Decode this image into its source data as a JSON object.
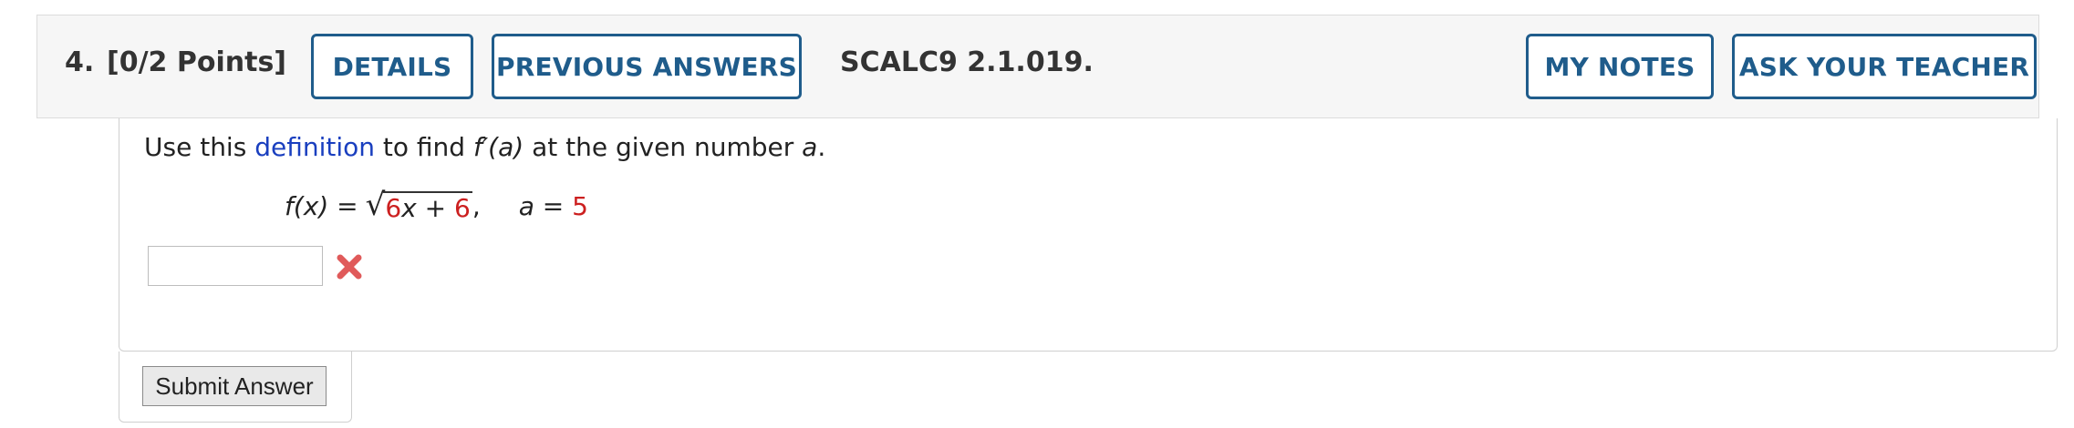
{
  "header": {
    "question_number": "4.",
    "points": "[0/2 Points]",
    "details_label": "DETAILS",
    "previous_answers_label": "PREVIOUS ANSWERS",
    "problem_code": "SCALC9 2.1.019.",
    "my_notes_label": "MY NOTES",
    "ask_teacher_label": "ASK YOUR TEACHER"
  },
  "problem": {
    "instruction_prefix": "Use this ",
    "instruction_link": "definition",
    "instruction_mid": " to find ",
    "fprime": "f′(a)",
    "instruction_suffix": " at the given number ",
    "instruction_a": "a",
    "instruction_end": ".",
    "fx_label": "f(x) = ",
    "radicand_coef": "6",
    "radicand_var": "x + ",
    "radicand_const": "6",
    "after_sqrt": ",",
    "a_label": "a = ",
    "a_value": "5"
  },
  "answer": {
    "value": "",
    "status_icon": "incorrect-x-icon"
  },
  "submit_label": "Submit Answer",
  "colors": {
    "accent": "#1f5c8b",
    "link": "#1a3fbf",
    "incorrect": "#d9534f",
    "red_values": "#cc1f1f"
  }
}
